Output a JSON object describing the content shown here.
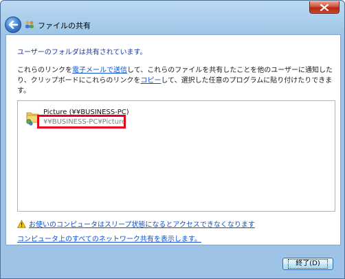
{
  "window": {
    "title": "ファイルの共有",
    "icons": {
      "back": "back-arrow-icon",
      "title": "people-share-icon",
      "close": "close-x-icon"
    },
    "colors": {
      "close_button": "#c9482c",
      "frame": "#a9cdec",
      "link": "#0a4fd0",
      "heading": "#1e3a9a",
      "highlight": "#e6001c"
    }
  },
  "content": {
    "heading": "ユーザーのフォルダは共有されています。",
    "description": {
      "part1": "これらのリンクを",
      "link_email": "電子メールで送信",
      "part2": "して、これらのファイルを共有したことを他のユーザーに通知したり、クリップボードにこれらのリンクを",
      "link_copy": "コピー",
      "part3": "して、選択した任意のプログラムに貼り付けたりできます。"
    },
    "shared_items": [
      {
        "name": "Picture (¥¥BUSINESS-PC)",
        "path": "¥¥BUSINESS-PC¥Picture",
        "icon": "shared-folder-icon"
      }
    ],
    "warning_link": "お使いのコンピュータはスリープ状態になるとアクセスできなくなります",
    "warning_icon": "warning-icon",
    "all_shares_link": "コンピュータ上のすべてのネットワーク共有を表示します。"
  },
  "footer": {
    "close_label": "終了(D)"
  }
}
